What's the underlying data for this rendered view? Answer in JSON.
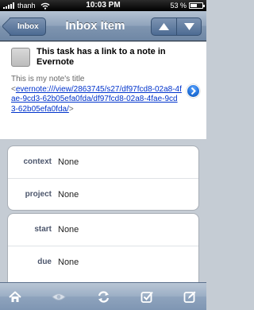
{
  "status_bar": {
    "carrier": "thanh",
    "time": "10:03 PM",
    "battery": "53 %",
    "battery_level": 0.53,
    "icons": [
      "signal-bars-icon",
      "wifi-icon",
      "battery-icon"
    ]
  },
  "nav": {
    "back_label": "Inbox",
    "title": "Inbox Item",
    "prev_icon": "triangle-up-icon",
    "next_icon": "triangle-down-icon"
  },
  "task": {
    "title": "This task has a link to a note in Evernote",
    "note_title": "This is my note's title",
    "link_open": "<",
    "link_url": "evernote:///view/2863745/s27/df97fcd8-02a8-4fae-9cd3-62b05efa0fda/df97fcd8-02a8-4fae-9cd3-62b05efa0fda/",
    "link_close": ">",
    "disclosure_icon": "chevron-right-icon"
  },
  "fields_group_1": [
    {
      "label": "context",
      "value": "None"
    },
    {
      "label": "project",
      "value": "None"
    }
  ],
  "fields_group_2": [
    {
      "label": "start",
      "value": "None"
    },
    {
      "label": "due",
      "value": "None"
    }
  ],
  "toolbar": {
    "icons": [
      "home-icon",
      "eye-icon",
      "refresh-icon",
      "checklist-icon",
      "compose-icon"
    ]
  },
  "colors": {
    "nav_bar": "#8097b3",
    "link": "#0033cc",
    "label": "#4c566c",
    "disclosure": "#1f6fd8",
    "background": "#c5ccd4"
  }
}
